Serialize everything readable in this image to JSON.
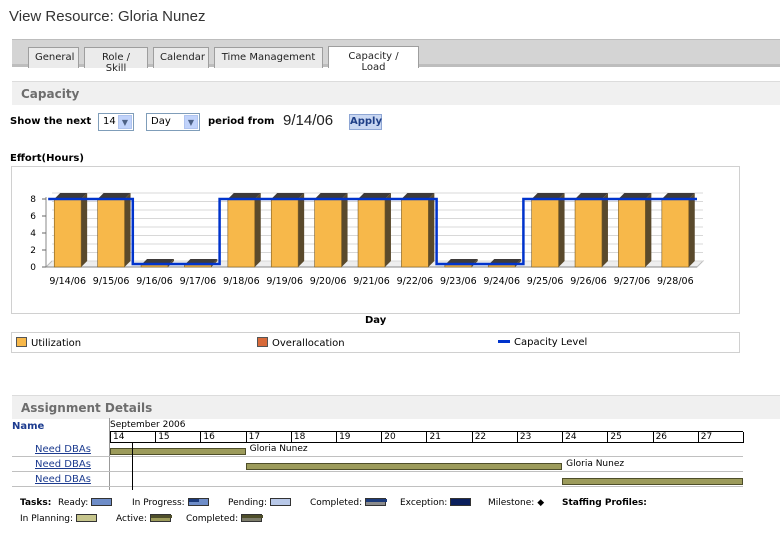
{
  "page": {
    "title": "View Resource: Gloria Nunez"
  },
  "tabs": [
    {
      "label": "General",
      "active": false
    },
    {
      "label": "Role / Skill",
      "active": false
    },
    {
      "label": "Calendar",
      "active": false
    },
    {
      "label": "Time Management",
      "active": false
    },
    {
      "label": "Capacity / Load",
      "active": true
    }
  ],
  "capacity": {
    "section_title": "Capacity",
    "show_the_next_label": "Show the next",
    "count_value": "14",
    "unit_value": "Day",
    "period_from_label": "period from",
    "from_date": "9/14/06",
    "apply_label": "Apply"
  },
  "chart_data": {
    "type": "bar",
    "title": "Effort(Hours)",
    "xlabel": "Day",
    "ylabel": "",
    "ylim": [
      0,
      8
    ],
    "yticks": [
      "0",
      "2",
      "4",
      "6",
      "8"
    ],
    "categories": [
      "9/14/06",
      "9/15/06",
      "9/16/06",
      "9/17/06",
      "9/18/06",
      "9/19/06",
      "9/20/06",
      "9/21/06",
      "9/22/06",
      "9/23/06",
      "9/24/06",
      "9/25/06",
      "9/26/06",
      "9/27/06",
      "9/28/06"
    ],
    "series": [
      {
        "name": "Utilization",
        "values": [
          8,
          8,
          0,
          0,
          8,
          8,
          8,
          8,
          8,
          0,
          0,
          8,
          8,
          8,
          8
        ],
        "color": "#f7b84a"
      },
      {
        "name": "Overallocation",
        "values": [
          0,
          0,
          0,
          0,
          0,
          0,
          0,
          0,
          0,
          0,
          0,
          0,
          0,
          0,
          0
        ],
        "color": "#d86a3a"
      },
      {
        "name": "Capacity Level",
        "values": [
          8,
          8,
          0,
          0,
          8,
          8,
          8,
          8,
          8,
          0,
          0,
          8,
          8,
          8,
          8
        ],
        "color": "#0033cc"
      }
    ],
    "grid": true
  },
  "assignments": {
    "section_title": "Assignment Details",
    "name_header": "Name",
    "month": "September 2006",
    "days": [
      "14",
      "15",
      "16",
      "17",
      "18",
      "19",
      "20",
      "21",
      "22",
      "23",
      "24",
      "25",
      "26",
      "27"
    ],
    "rows": [
      {
        "name": "Need DBAs",
        "resource": "Gloria Nunez",
        "start_day": 0,
        "end_day": 3
      },
      {
        "name": "Need DBAs",
        "resource": "Gloria Nunez",
        "start_day": 3,
        "end_day": 10
      },
      {
        "name": "Need DBAs",
        "resource": "",
        "start_day": 10,
        "end_day": 14
      }
    ]
  },
  "gantt_legend": {
    "tasks_label": "Tasks:",
    "ready": "Ready:",
    "in_progress": "In Progress:",
    "pending": "Pending:",
    "completed": "Completed:",
    "exception": "Exception:",
    "milestone": "Milestone:",
    "milestone_glyph": "◆",
    "staffing_profiles": "Staffing Profiles:",
    "in_planning": "In Planning:",
    "active": "Active:",
    "completed2": "Completed:"
  }
}
